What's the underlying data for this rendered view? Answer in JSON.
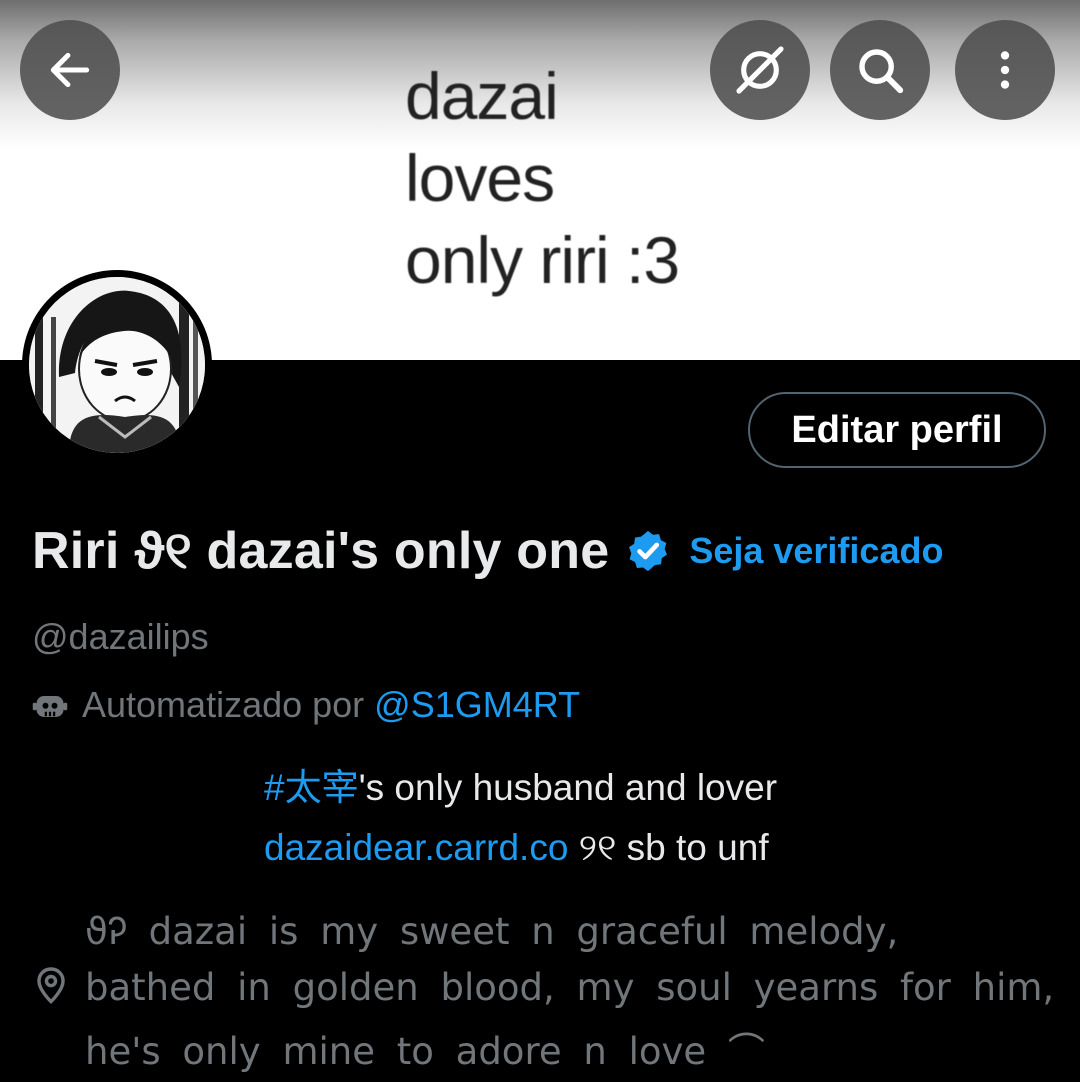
{
  "banner": {
    "lines": [
      "dazai",
      "loves",
      "only riri :3"
    ]
  },
  "top_bar": {
    "back_icon": "arrow-left-icon",
    "grok_icon": "slash-circle-icon",
    "search_icon": "search-icon",
    "more_icon": "more-vertical-icon"
  },
  "profile": {
    "edit_button": "Editar perfil",
    "name": "Riri ϑ୧ dazai's only one",
    "verified_icon": "verified-badge-icon",
    "get_verified": "Seja verificado",
    "handle": "@dazailips",
    "automated_label": "Automatizado por",
    "automated_by": "@S1GM4RT",
    "bio": {
      "hashtag": "#太宰",
      "line1_rest": "'s only husband and lover",
      "link": "dazaidear.carrd.co",
      "line2_rest": " ୨୧ sb to unf"
    },
    "location": {
      "icon": "location-pin-icon",
      "line1": "ϑᎮ  dazai is my sweet n graceful melody,",
      "line2": "bathed in golden blood, my soul yearns for him,",
      "line3": "he's only mine to adore n love ⌒"
    }
  },
  "colors": {
    "accent": "#1d9bf0",
    "muted": "#71767b",
    "text": "#e7e9ea",
    "background": "#000000"
  }
}
